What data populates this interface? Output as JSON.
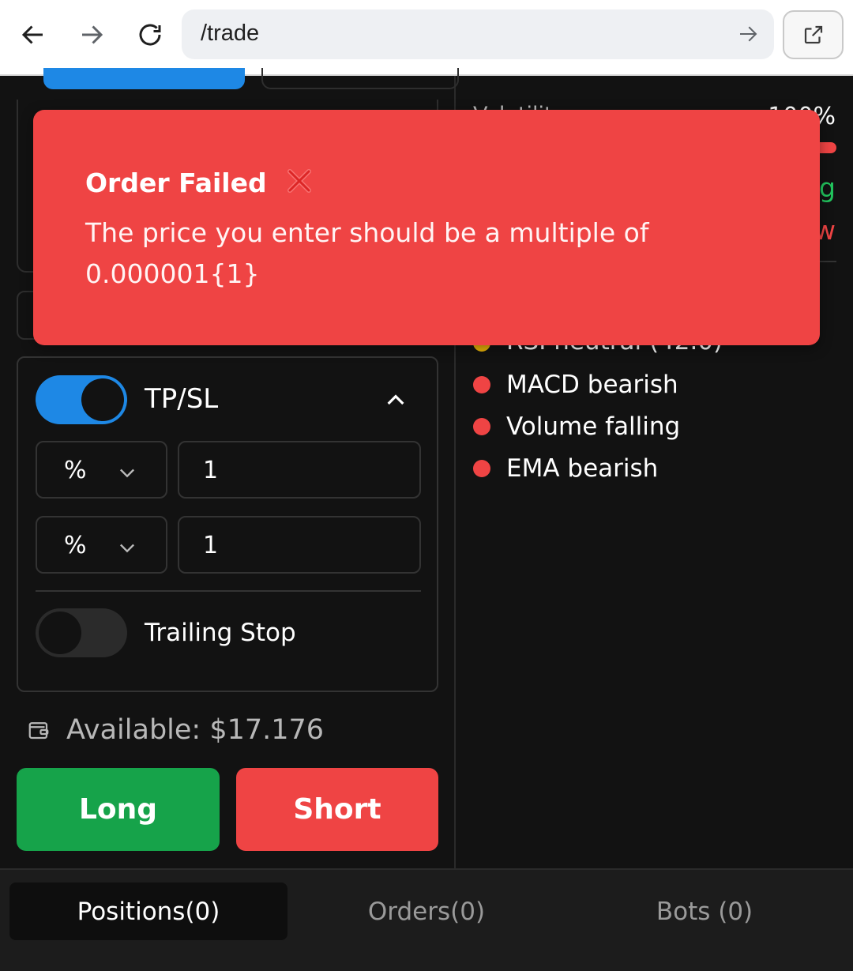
{
  "browser": {
    "url": "/trade",
    "back_icon": "arrow-left-icon",
    "forward_icon": "arrow-right-icon",
    "reload_icon": "reload-icon",
    "go_icon": "arrow-right-icon",
    "external_icon": "external-link-icon"
  },
  "toast": {
    "title": "Order Failed",
    "icon": "cross-mark-icon",
    "message": "The price you enter should be a multiple of 0.000001{1}",
    "color": "#ef4444"
  },
  "order_form": {
    "tpsl": {
      "label": "TP/SL",
      "enabled": true,
      "take_profit": {
        "unit": "%",
        "value": "1"
      },
      "stop_loss": {
        "unit": "%",
        "value": "1"
      }
    },
    "trailing_stop": {
      "label": "Trailing Stop",
      "enabled": false
    },
    "available": "Available: $17.176",
    "long_label": "Long",
    "short_label": "Short",
    "colors": {
      "accent": "#1e88e5",
      "long": "#16a34a",
      "short": "#ef4444"
    }
  },
  "analysis": {
    "volatility_label": "Volatility",
    "volatility_value": "100%",
    "signal_green_partial": "g",
    "signal_red_partial": "w",
    "rsi_partial": "RSI neutral (42.0)",
    "indicators": [
      {
        "label": "MACD bearish",
        "status": "bearish"
      },
      {
        "label": "Volume falling",
        "status": "bearish"
      },
      {
        "label": "EMA bearish",
        "status": "bearish"
      }
    ]
  },
  "tabs": [
    {
      "label": "Positions(0)",
      "active": true
    },
    {
      "label": "Orders(0)",
      "active": false
    },
    {
      "label": "Bots (0)",
      "active": false
    }
  ]
}
